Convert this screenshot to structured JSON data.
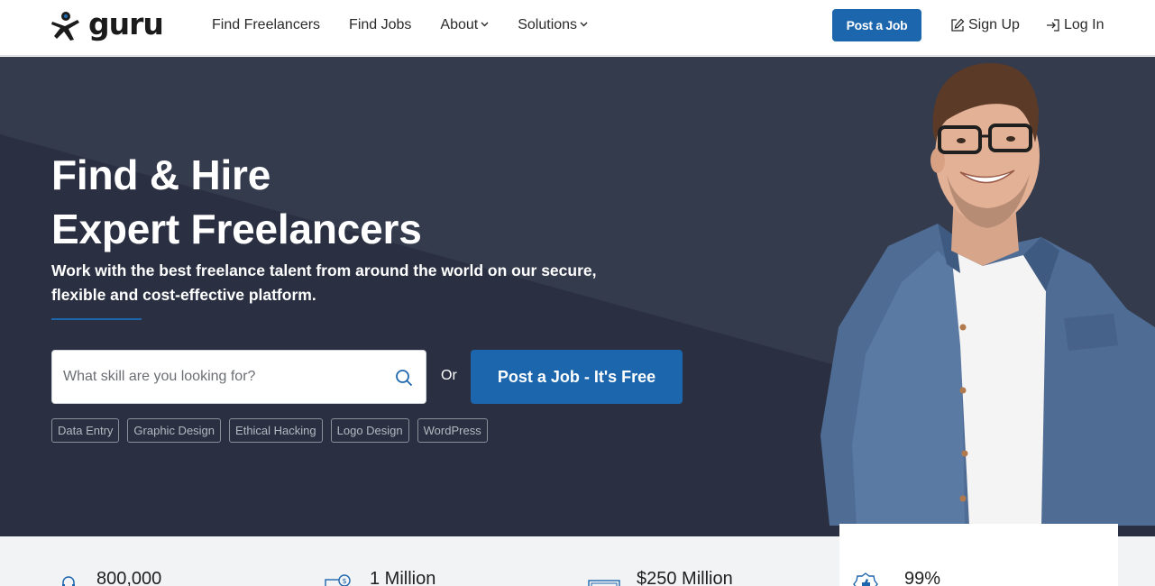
{
  "brand": {
    "name": "guru",
    "accent": "#1c66ad",
    "hero_bg": "#2f3546"
  },
  "header": {
    "nav": [
      {
        "label": "Find Freelancers",
        "has_dropdown": false
      },
      {
        "label": "Find Jobs",
        "has_dropdown": false
      },
      {
        "label": "About",
        "has_dropdown": true
      },
      {
        "label": "Solutions",
        "has_dropdown": true
      }
    ],
    "post_job_label": "Post a Job",
    "sign_up_label": "Sign Up",
    "log_in_label": "Log In"
  },
  "hero": {
    "title_line1": "Find & Hire",
    "title_line2": "Expert Freelancers",
    "subtitle": "Work with the best freelance talent from around the world on our secure, flexible and cost-effective platform.",
    "search_placeholder": "What skill are you looking for?",
    "or_label": "Or",
    "post_job_label": "Post a Job - It's Free",
    "tags": [
      "Data Entry",
      "Graphic Design",
      "Ethical Hacking",
      "Logo Design",
      "WordPress"
    ]
  },
  "stats": [
    {
      "icon": "headset-icon",
      "value": "800,000"
    },
    {
      "icon": "money-icon",
      "value": "1 Million"
    },
    {
      "icon": "cash-icon",
      "value": "$250 Million"
    },
    {
      "icon": "badge-thumbs-up-icon",
      "value": "99%"
    }
  ]
}
